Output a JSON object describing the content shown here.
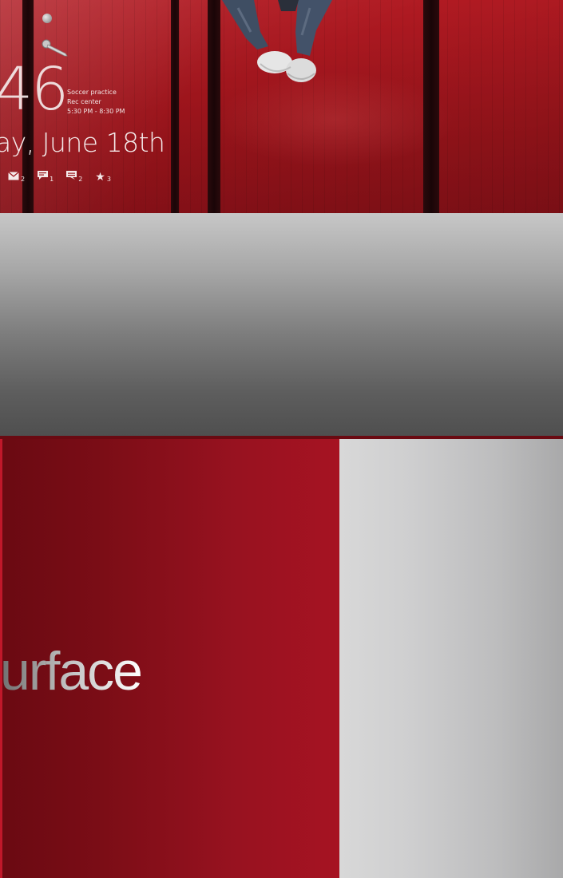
{
  "lock_screen": {
    "time": "46",
    "appointment": {
      "title": "Soccer practice",
      "location": "Rec center",
      "time": "5:30 PM - 8:30 PM"
    },
    "date": "ay, June 18th",
    "notifications": [
      {
        "icon": "mail-icon",
        "glyph": "✉",
        "count": "2"
      },
      {
        "icon": "chat-icon",
        "glyph": "💬",
        "count": "1"
      },
      {
        "icon": "message-icon",
        "glyph": "💬",
        "count": "2"
      },
      {
        "icon": "star-icon",
        "glyph": "★",
        "count": "3"
      }
    ]
  },
  "surface_panel": {
    "brand_text": "urface"
  },
  "colors": {
    "lock_red": "#b01a22",
    "surface_red": "#a61322",
    "surface_gray": "#cfcfd0",
    "band_gray_top": "#c7c7c7",
    "band_gray_bottom": "#4f4f4f"
  }
}
